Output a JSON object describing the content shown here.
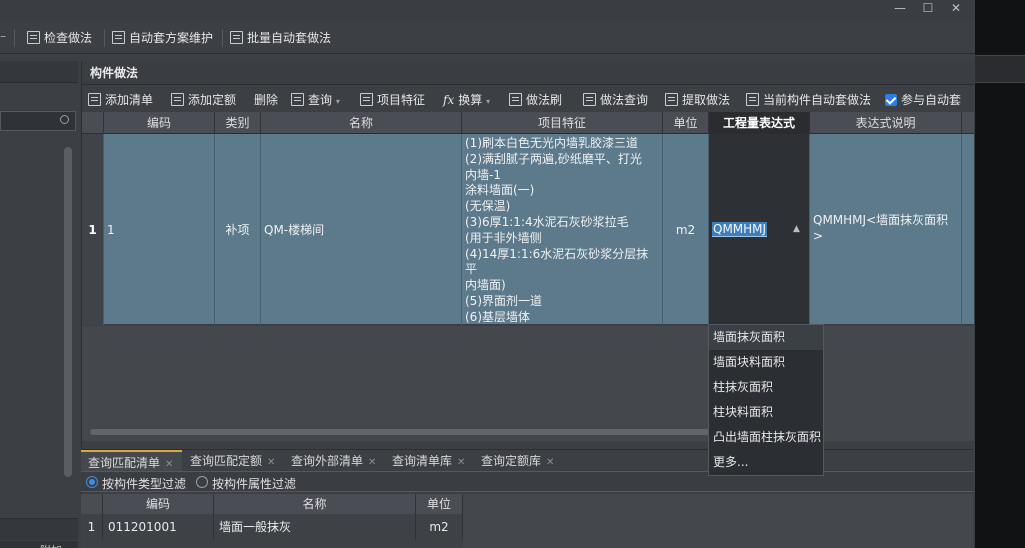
{
  "window": {
    "min": "—",
    "max": "☐",
    "close": "✕"
  },
  "top_toolbar": {
    "partial": "⁻",
    "check": "检查做法",
    "auto_maint": "自动套方案维护",
    "batch_auto": "批量自动套做法"
  },
  "panel": {
    "title": "构件做法"
  },
  "component_toolbar": {
    "add_bill": "添加清单",
    "add_quota": "添加定额",
    "delete": "删除",
    "query": "查询",
    "features": "项目特征",
    "convert": "换算",
    "brush": "做法刷",
    "method_query": "做法查询",
    "extract": "提取做法",
    "current_auto": "当前构件自动套做法",
    "join_auto": "参与自动套"
  },
  "grid": {
    "headers": [
      "编码",
      "类别",
      "名称",
      "项目特征",
      "单位",
      "工程量表达式",
      "表达式说明"
    ],
    "row": {
      "no": "1",
      "code": "1",
      "category": "补项",
      "name": "QM-楼梯间",
      "features": [
        "(1)刷本白色无光内墙乳胶漆三道",
        "(2)满刮腻子两遍,砂纸磨平、打光",
        "内墙-1",
        "涂料墙面(一)",
        "(无保温)",
        "(3)6厚1:1:4水泥石灰砂浆拉毛",
        "(用于非外墙侧",
        "(4)14厚1:1:6水泥石灰砂浆分层抹平",
        "内墙面)",
        "(5)界面剂一道",
        "(6)基层墙体"
      ],
      "unit": "m2",
      "expression": "QMMHMJ",
      "expr_desc": "QMMHMJ<墙面抹灰面积>"
    }
  },
  "dropdown": [
    "墙面抹灰面积",
    "墙面块料面积",
    "柱抹灰面积",
    "柱块料面积",
    "凸出墙面柱抹灰面积",
    "更多..."
  ],
  "bottom_tabs": [
    "查询匹配清单",
    "查询匹配定额",
    "查询外部清单",
    "查询清单库",
    "查询定额库"
  ],
  "filters": {
    "by_type": "按构件类型过滤",
    "by_attr": "按构件属性过滤"
  },
  "bottom_grid": {
    "headers": [
      "编码",
      "名称",
      "单位"
    ],
    "rows": [
      {
        "no": "1",
        "code": "011201001",
        "name": "墙面一般抹灰",
        "unit": "m2"
      }
    ]
  },
  "left": {
    "attach": "附加"
  }
}
